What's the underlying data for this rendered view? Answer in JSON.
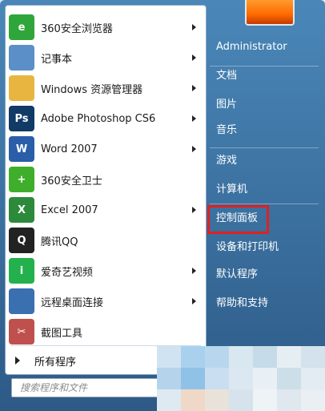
{
  "programs": [
    {
      "label": "360安全浏览器",
      "icon": "browser-360-icon",
      "color": "#2fa63a",
      "glyph": "e",
      "arrow": true
    },
    {
      "label": "记事本",
      "icon": "notepad-icon",
      "color": "#5b8fc7",
      "glyph": "",
      "arrow": true
    },
    {
      "label": "Windows 资源管理器",
      "icon": "explorer-folder-icon",
      "color": "#e8b640",
      "glyph": "",
      "arrow": true
    },
    {
      "label": "Adobe Photoshop CS6",
      "icon": "photoshop-icon",
      "color": "#123a66",
      "glyph": "Ps",
      "arrow": true
    },
    {
      "label": "Word 2007",
      "icon": "word-icon",
      "color": "#2a5ea8",
      "glyph": "W",
      "arrow": true
    },
    {
      "label": "360安全卫士",
      "icon": "security-360-icon",
      "color": "#3fae2a",
      "glyph": "+",
      "arrow": false
    },
    {
      "label": "Excel 2007",
      "icon": "excel-icon",
      "color": "#2c8a3a",
      "glyph": "X",
      "arrow": true
    },
    {
      "label": "腾讯QQ",
      "icon": "qq-penguin-icon",
      "color": "#222222",
      "glyph": "Q",
      "arrow": false
    },
    {
      "label": "爱奇艺视频",
      "icon": "iqiyi-icon",
      "color": "#22b14c",
      "glyph": "i",
      "arrow": true
    },
    {
      "label": "远程桌面连接",
      "icon": "remote-desktop-icon",
      "color": "#3a6fb0",
      "glyph": "",
      "arrow": true
    },
    {
      "label": "截图工具",
      "icon": "snipping-tool-icon",
      "color": "#c0504d",
      "glyph": "✂",
      "arrow": false
    }
  ],
  "all_programs": "所有程序",
  "search_placeholder": "搜索程序和文件",
  "right_items": [
    {
      "label": "Administrator",
      "name": "user-name"
    },
    {
      "label": "文档",
      "name": "documents"
    },
    {
      "label": "图片",
      "name": "pictures"
    },
    {
      "label": "音乐",
      "name": "music"
    },
    {
      "label": "游戏",
      "name": "games"
    },
    {
      "label": "计算机",
      "name": "computer"
    },
    {
      "label": "控制面板",
      "name": "control-panel"
    },
    {
      "label": "设备和打印机",
      "name": "devices-printers"
    },
    {
      "label": "默认程序",
      "name": "default-programs"
    },
    {
      "label": "帮助和支持",
      "name": "help-support"
    }
  ]
}
